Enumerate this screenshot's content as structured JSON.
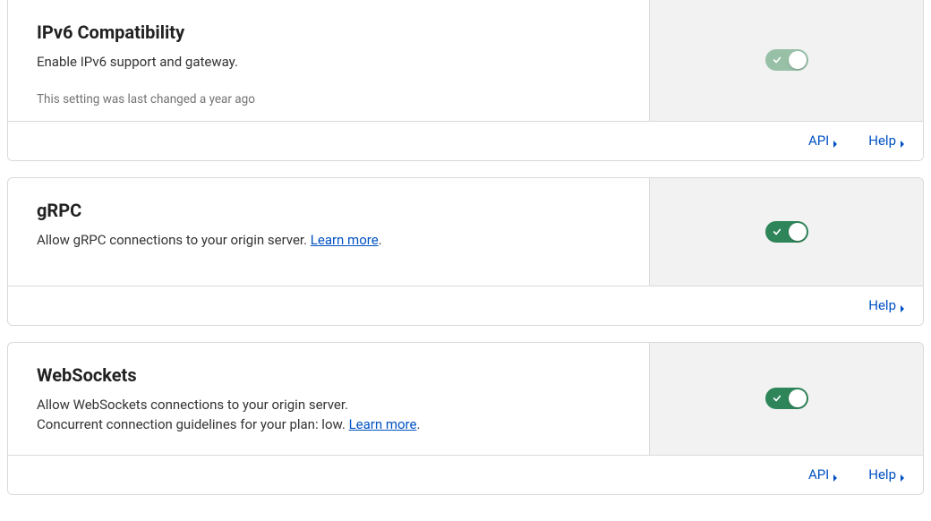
{
  "common": {
    "api_label": "API",
    "help_label": "Help",
    "learn_more": "Learn more"
  },
  "cards": {
    "ipv6": {
      "title": "IPv6 Compatibility",
      "description": "Enable IPv6 support and gateway.",
      "meta": "This setting was last changed a year ago",
      "toggle_state": "on-muted",
      "show_api": true,
      "show_help": true
    },
    "grpc": {
      "title": "gRPC",
      "description_pre": "Allow gRPC connections to your origin server. ",
      "description_post": ".",
      "toggle_state": "on-solid",
      "show_api": false,
      "show_help": true
    },
    "websockets": {
      "title": "WebSockets",
      "line1": "Allow WebSockets connections to your origin server.",
      "line2_pre": "Concurrent connection guidelines for your plan: low. ",
      "line2_post": ".",
      "toggle_state": "on-solid",
      "show_api": true,
      "show_help": true
    }
  }
}
